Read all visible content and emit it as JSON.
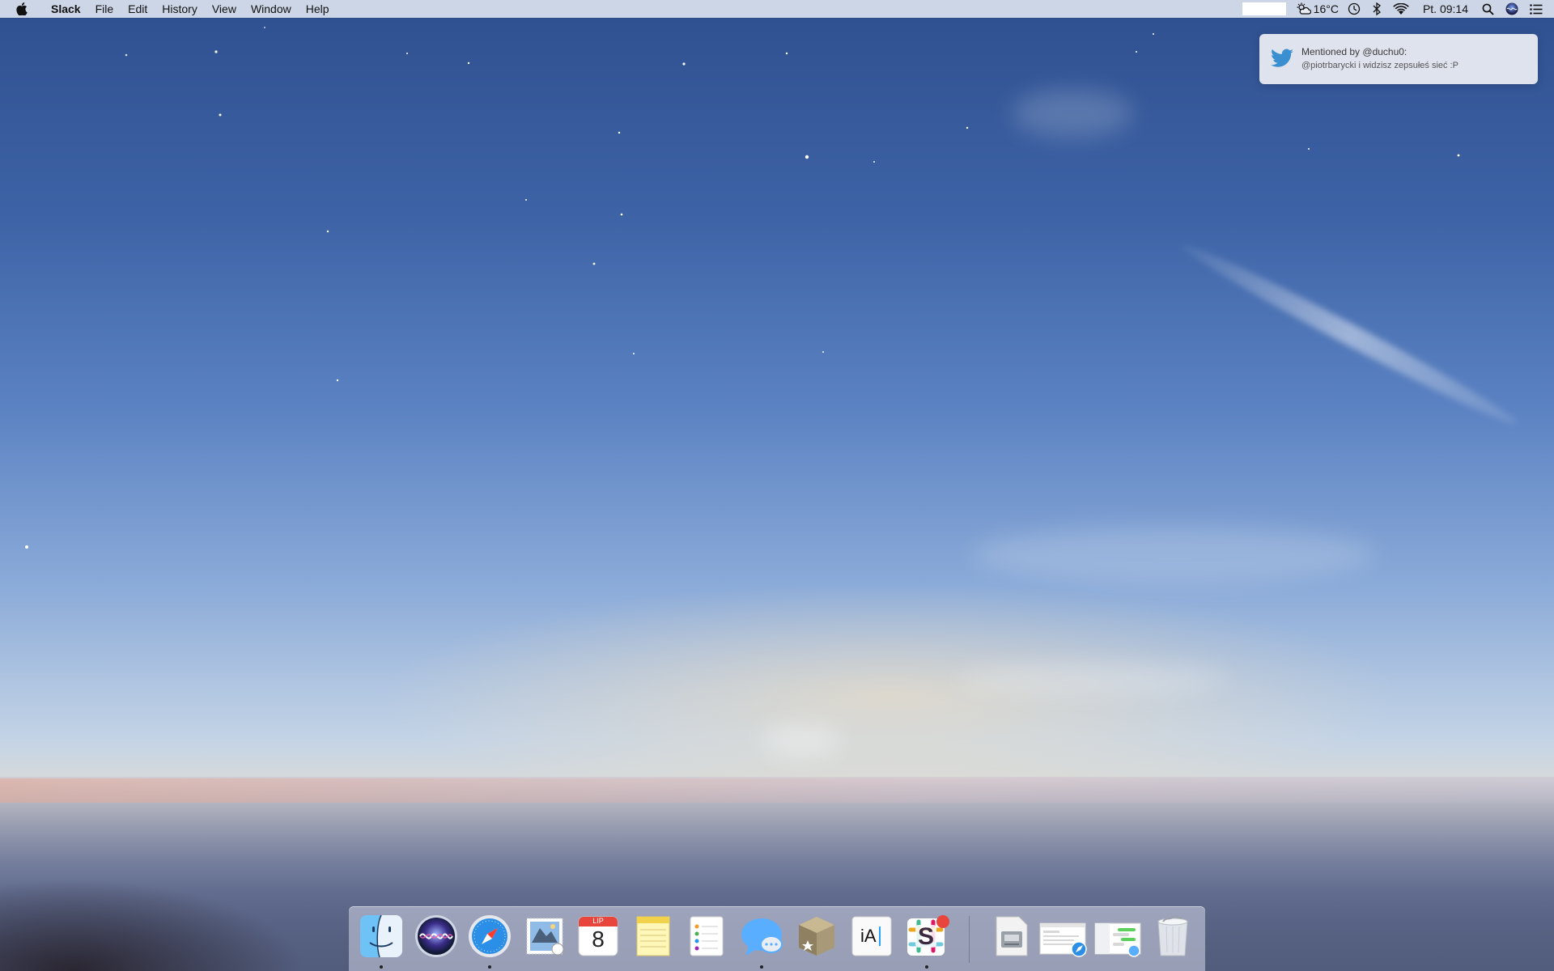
{
  "menubar": {
    "app_name": "Slack",
    "menus": [
      "File",
      "Edit",
      "History",
      "View",
      "Window",
      "Help"
    ],
    "status": {
      "weather_icon": "partly-cloudy-icon",
      "temperature": "16°C",
      "clock": "Pt. 09:14"
    }
  },
  "notification": {
    "icon": "twitter-bird-icon",
    "title": "Mentioned by @duchu0:",
    "body": "@piotrbarycki i widzisz zepsułeś sieć :P"
  },
  "dock": {
    "apps": [
      {
        "name": "finder-icon",
        "running": true
      },
      {
        "name": "siri-icon",
        "running": false
      },
      {
        "name": "safari-icon",
        "running": true
      },
      {
        "name": "mail-icon",
        "running": false
      },
      {
        "name": "calendar-icon",
        "running": false,
        "month": "LIP",
        "day": "8"
      },
      {
        "name": "notes-icon",
        "running": false
      },
      {
        "name": "reminders-icon",
        "running": false
      },
      {
        "name": "messages-icon",
        "running": true
      },
      {
        "name": "archive-box-icon",
        "running": false
      },
      {
        "name": "ia-writer-icon",
        "running": false,
        "label": "iA"
      },
      {
        "name": "slack-icon",
        "running": true,
        "label": "S"
      },
      {
        "name": "disk-utility-icon",
        "running": false
      },
      {
        "name": "safari-window-stack-icon",
        "running": false
      },
      {
        "name": "messages-window-stack-icon",
        "running": false
      },
      {
        "name": "trash-icon",
        "running": false
      }
    ]
  }
}
